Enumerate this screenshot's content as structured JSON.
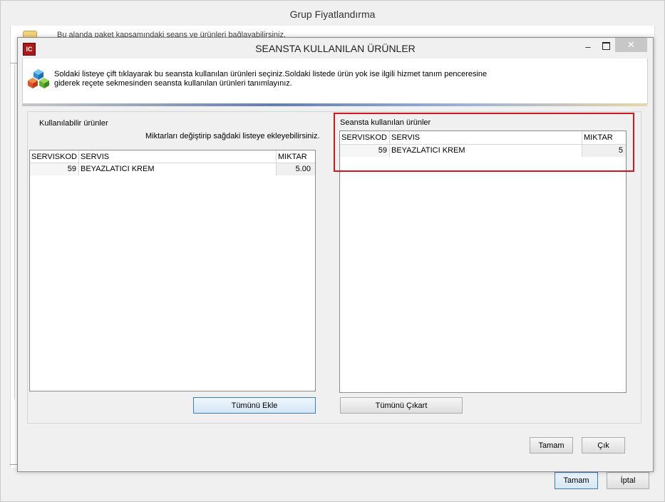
{
  "outer": {
    "title": "Grup Fiyatlandırma",
    "hint": "Bu alanda paket kapsamındaki seans ve ürünleri bağlayabilirsiniz.",
    "ok_label": "Tamam",
    "cancel_label": "İptal"
  },
  "dialog": {
    "title": "SEANSTA KULLANILAN ÜRÜNLER",
    "app_icon_text": "IC",
    "min_glyph": "–",
    "close_glyph": "✕",
    "info_line1": "Soldaki listeye çift tıklayarak bu seansta kullanılan ürünleri seçiniz.Soldaki listede ürün yok ise ilgili hizmet tanım penceresine",
    "info_line2": "giderek reçete sekmesinden seansta kullanılan ürünleri tanımlayınız.",
    "ok_label": "Tamam",
    "exit_label": "Çık"
  },
  "left": {
    "title": "Kullanılabilir ürünler",
    "hint": "Miktarları değiştirip sağdaki listeye ekleyebilirsiniz.",
    "columns": [
      "SERVISKOD",
      "SERVIS",
      "MIKTAR"
    ],
    "rows": [
      {
        "kod": "59",
        "servis": "BEYAZLATICI KREM",
        "miktar": "5.00"
      }
    ],
    "add_all_label": "Tümünü Ekle"
  },
  "right": {
    "title": "Seansta kullanılan ürünler",
    "columns": [
      "SERVISKOD",
      "SERVIS",
      "MIKTAR"
    ],
    "rows": [
      {
        "kod": "59",
        "servis": "BEYAZLATICI KREM",
        "miktar": "5"
      }
    ],
    "remove_all_label": "Tümünü Çıkart"
  },
  "colors": {
    "highlight": "#d2161d",
    "focus_border": "#3c7fb1",
    "close_button": "#c7c7c7"
  }
}
